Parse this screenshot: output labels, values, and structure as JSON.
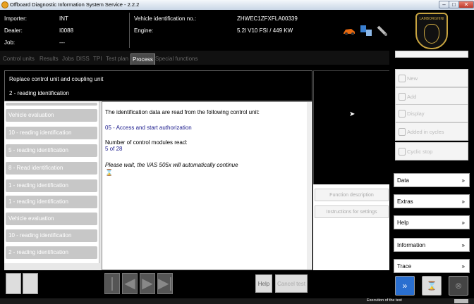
{
  "window": {
    "title": "Offboard Diagnostic Information System Service - 2.2.2"
  },
  "header": {
    "importer_label": "Importer:",
    "importer_value": "INT",
    "dealer_label": "Dealer:",
    "dealer_value": "I0088",
    "job_label": "Job:",
    "job_value": "---",
    "vin_label": "Vehicle identification no.:",
    "vin_value": "ZHWEC1ZFXFLA00339",
    "engine_label": "Engine:",
    "engine_value": "5.2l V10 FSI / 449 KW"
  },
  "logo": {
    "brand": "LAMBORGHINI"
  },
  "tabs": [
    "Control units",
    "Results",
    "Jobs",
    "DISS",
    "TPI",
    "Test plan",
    "Process",
    "Special functions"
  ],
  "active_tab": "Process",
  "process": {
    "title": "Replace control unit and coupling unit",
    "subtitle": "2 - reading identification"
  },
  "steps": [
    "Vehicle evaluation",
    "10 - reading identification",
    "5 - reading identification",
    "8 - Read identification",
    "1 - reading identification",
    "1 - reading identification",
    "Vehicle evaluation",
    "10 - reading identification",
    "2 - reading identification"
  ],
  "message": {
    "intro": "The identification data are read from the following control unit:",
    "unit": "05 - Access and start authorization",
    "count_label": "Number of control modules read:",
    "count_value": "5 of 28",
    "wait": "Please wait, the VAS 505x will automatically continue"
  },
  "side_buttons": {
    "function_description": "Function description",
    "instructions": "Instructions for settings"
  },
  "bottom": {
    "help": "Help",
    "cancel": "Cancel test"
  },
  "right_panel": {
    "buttons": [
      "New",
      "Add",
      "Display",
      "Added in cycles",
      "Cyclic stop"
    ],
    "menus": [
      "Data",
      "Extras",
      "Help",
      "Information",
      "Trace"
    ]
  },
  "status_text": "Execution of the test"
}
